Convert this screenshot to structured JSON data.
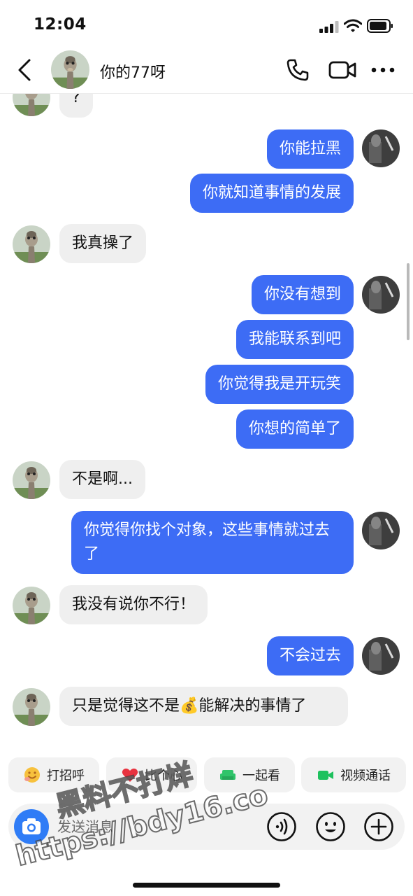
{
  "status_bar": {
    "time": "12:04"
  },
  "header": {
    "contact_name": "你的77呀"
  },
  "messages": [
    {
      "side": "in",
      "text": "?"
    },
    {
      "side": "out",
      "text": "你能拉黑"
    },
    {
      "side": "out",
      "text": "你就知道事情的发展"
    },
    {
      "side": "in",
      "text": "我真操了"
    },
    {
      "side": "out",
      "text": "你没有想到"
    },
    {
      "side": "out",
      "text": "我能联系到吧"
    },
    {
      "side": "out",
      "text": "你觉得我是开玩笑"
    },
    {
      "side": "out",
      "text": "你想的简单了"
    },
    {
      "side": "in",
      "text": "不是啊..."
    },
    {
      "side": "out",
      "text": "你觉得你找个对象，这些事情就过去了"
    },
    {
      "side": "in",
      "text": "我没有说你不行！"
    },
    {
      "side": "out",
      "text": "不会过去"
    },
    {
      "side": "in",
      "text": "只是觉得这不是💰能解决的事情了"
    }
  ],
  "quick_actions": [
    {
      "label": "打招呼",
      "icon": "wave-emoji-icon"
    },
    {
      "label": "比个心",
      "icon": "heart-icon"
    },
    {
      "label": "一起看",
      "icon": "sofa-icon"
    },
    {
      "label": "视频通话",
      "icon": "video-call-icon"
    }
  ],
  "input": {
    "placeholder": "发送消息"
  },
  "watermark": {
    "line1": "黑料不打烊",
    "line2": "https://bdy16.co"
  },
  "colors": {
    "outgoing_bubble": "#3d6cf5",
    "incoming_bubble": "#efefef",
    "camera_button": "#2f7cf6"
  }
}
